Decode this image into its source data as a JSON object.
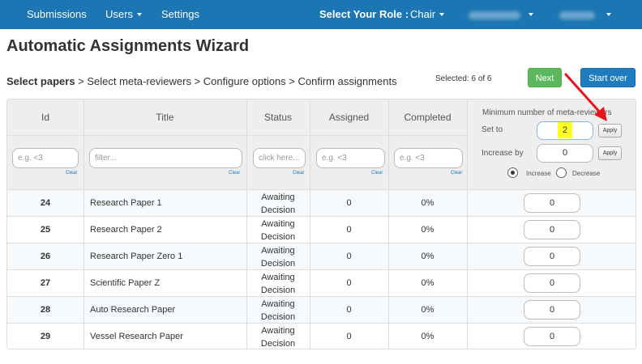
{
  "nav": {
    "items": [
      {
        "label": "Submissions"
      },
      {
        "label": "Users"
      },
      {
        "label": "Settings"
      }
    ],
    "role_label": "Select Your Role :",
    "role_value": "Chair"
  },
  "page": {
    "title": "Automatic Assignments Wizard",
    "steps": {
      "current": "Select papers",
      "rest": " > Select meta-reviewers > Configure options > Confirm assignments"
    },
    "selected_text": "Selected: 6 of 6",
    "next_label": "Next",
    "startover_label": "Start over"
  },
  "table": {
    "headers": {
      "id": "Id",
      "title": "Title",
      "status": "Status",
      "assigned": "Assigned",
      "completed": "Completed"
    },
    "filters": {
      "id_placeholder": "e.g. <3",
      "title_placeholder": "filter...",
      "status_placeholder": "click here...",
      "assigned_placeholder": "e.g. <3",
      "completed_placeholder": "e.g. <3",
      "clear_label": "Clear"
    },
    "meta": {
      "title": "Minimum number of meta-reviewers",
      "set_to_label": "Set to",
      "set_to_value": "2",
      "increase_by_label": "Increase by",
      "increase_by_value": "0",
      "apply_label": "Apply",
      "increase_label": "Increase",
      "decrease_label": "Decrease",
      "selected_mode": "Increase"
    },
    "rows": [
      {
        "id": "24",
        "title": "Research Paper 1",
        "status": "Awaiting Decision",
        "assigned": "0",
        "completed": "0%",
        "min_meta": "0"
      },
      {
        "id": "25",
        "title": "Research Paper 2",
        "status": "Awaiting Decision",
        "assigned": "0",
        "completed": "0%",
        "min_meta": "0"
      },
      {
        "id": "26",
        "title": "Research Paper Zero 1",
        "status": "Awaiting Decision",
        "assigned": "0",
        "completed": "0%",
        "min_meta": "0"
      },
      {
        "id": "27",
        "title": "Scientific Paper Z",
        "status": "Awaiting Decision",
        "assigned": "0",
        "completed": "0%",
        "min_meta": "0"
      },
      {
        "id": "28",
        "title": "Auto Research Paper",
        "status": "Awaiting Decision",
        "assigned": "0",
        "completed": "0%",
        "min_meta": "0"
      },
      {
        "id": "29",
        "title": "Vessel Research Paper",
        "status": "Awaiting Decision",
        "assigned": "0",
        "completed": "0%",
        "min_meta": "0"
      }
    ]
  },
  "colors": {
    "navbar": "#1b76b3",
    "next_button": "#5cb85c",
    "startover_button": "#1f7cbf",
    "highlight": "#ffff22",
    "annotation_arrow": "#e8141c"
  },
  "icons": {
    "dropdown": "caret-down-icon",
    "annotation": "red-arrow-annotation"
  }
}
